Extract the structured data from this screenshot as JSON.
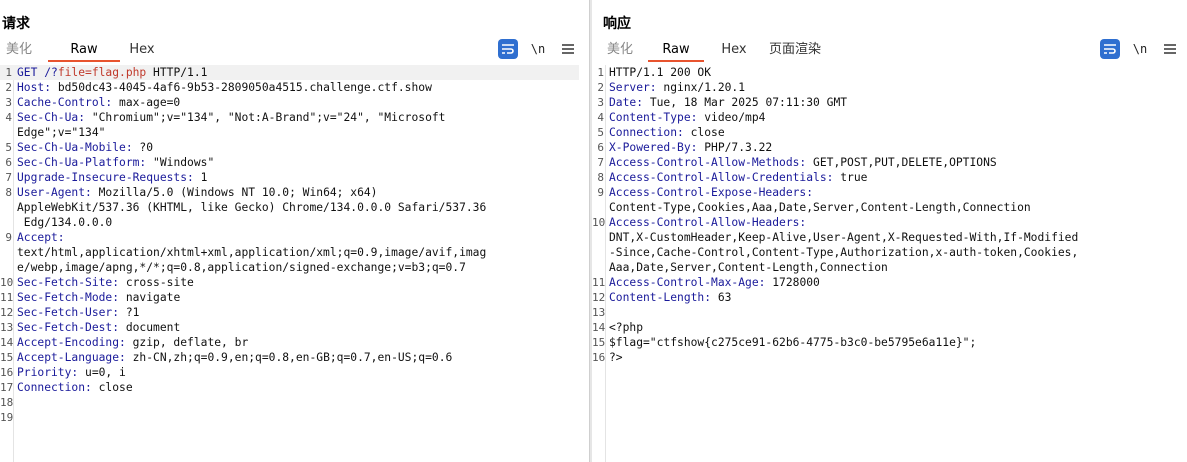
{
  "request": {
    "title": "请求",
    "tabs": [
      "美化",
      "Raw",
      "Hex"
    ],
    "active_tab": "Raw",
    "tool_newline": "\\n",
    "lines": [
      {
        "n": "1",
        "h": "GET /?",
        "p": "file=flag.php",
        "v": " HTTP/1.1"
      },
      {
        "n": "2",
        "h": "Host:",
        "v": " bd50dc43-4045-4af6-9b53-2809050a4515.challenge.ctf.show"
      },
      {
        "n": "3",
        "h": "Cache-Control:",
        "v": " max-age=0"
      },
      {
        "n": "4",
        "h": "Sec-Ch-Ua:",
        "v": " \"Chromium\";v=\"134\", \"Not:A-Brand\";v=\"24\", \"Microsoft"
      },
      {
        "n": "",
        "h": "",
        "v": "Edge\";v=\"134\""
      },
      {
        "n": "5",
        "h": "Sec-Ch-Ua-Mobile:",
        "v": " ?0"
      },
      {
        "n": "6",
        "h": "Sec-Ch-Ua-Platform:",
        "v": " \"Windows\""
      },
      {
        "n": "7",
        "h": "Upgrade-Insecure-Requests:",
        "v": " 1"
      },
      {
        "n": "8",
        "h": "User-Agent:",
        "v": " Mozilla/5.0 (Windows NT 10.0; Win64; x64)"
      },
      {
        "n": "",
        "h": "",
        "v": "AppleWebKit/537.36 (KHTML, like Gecko) Chrome/134.0.0.0 Safari/537.36"
      },
      {
        "n": "",
        "h": "",
        "v": " Edg/134.0.0.0"
      },
      {
        "n": "9",
        "h": "Accept:",
        "v": ""
      },
      {
        "n": "",
        "h": "",
        "v": "text/html,application/xhtml+xml,application/xml;q=0.9,image/avif,imag"
      },
      {
        "n": "",
        "h": "",
        "v": "e/webp,image/apng,*/*;q=0.8,application/signed-exchange;v=b3;q=0.7"
      },
      {
        "n": "10",
        "h": "Sec-Fetch-Site:",
        "v": " cross-site"
      },
      {
        "n": "11",
        "h": "Sec-Fetch-Mode:",
        "v": " navigate"
      },
      {
        "n": "12",
        "h": "Sec-Fetch-User:",
        "v": " ?1"
      },
      {
        "n": "13",
        "h": "Sec-Fetch-Dest:",
        "v": " document"
      },
      {
        "n": "14",
        "h": "Accept-Encoding:",
        "v": " gzip, deflate, br"
      },
      {
        "n": "15",
        "h": "Accept-Language:",
        "v": " zh-CN,zh;q=0.9,en;q=0.8,en-GB;q=0.7,en-US;q=0.6"
      },
      {
        "n": "16",
        "h": "Priority:",
        "v": " u=0, i"
      },
      {
        "n": "17",
        "h": "Connection:",
        "v": " close"
      },
      {
        "n": "18",
        "h": "",
        "v": ""
      },
      {
        "n": "19",
        "h": "",
        "v": ""
      }
    ]
  },
  "response": {
    "title": "响应",
    "tabs": [
      "美化",
      "Raw",
      "Hex",
      "页面渲染"
    ],
    "active_tab": "Raw",
    "tool_newline": "\\n",
    "lines": [
      {
        "n": "1",
        "h": "",
        "v": "HTTP/1.1 200 OK"
      },
      {
        "n": "2",
        "h": "Server:",
        "v": " nginx/1.20.1"
      },
      {
        "n": "3",
        "h": "Date:",
        "v": " Tue, 18 Mar 2025 07:11:30 GMT"
      },
      {
        "n": "4",
        "h": "Content-Type:",
        "v": " video/mp4"
      },
      {
        "n": "5",
        "h": "Connection:",
        "v": " close"
      },
      {
        "n": "6",
        "h": "X-Powered-By:",
        "v": " PHP/7.3.22"
      },
      {
        "n": "7",
        "h": "Access-Control-Allow-Methods:",
        "v": " GET,POST,PUT,DELETE,OPTIONS"
      },
      {
        "n": "8",
        "h": "Access-Control-Allow-Credentials:",
        "v": " true"
      },
      {
        "n": "9",
        "h": "Access-Control-Expose-Headers:",
        "v": ""
      },
      {
        "n": "",
        "h": "",
        "v": "Content-Type,Cookies,Aaa,Date,Server,Content-Length,Connection"
      },
      {
        "n": "10",
        "h": "Access-Control-Allow-Headers:",
        "v": ""
      },
      {
        "n": "",
        "h": "",
        "v": "DNT,X-CustomHeader,Keep-Alive,User-Agent,X-Requested-With,If-Modified"
      },
      {
        "n": "",
        "h": "",
        "v": "-Since,Cache-Control,Content-Type,Authorization,x-auth-token,Cookies,"
      },
      {
        "n": "",
        "h": "",
        "v": "Aaa,Date,Server,Content-Length,Connection"
      },
      {
        "n": "11",
        "h": "Access-Control-Max-Age:",
        "v": " 1728000"
      },
      {
        "n": "12",
        "h": "Content-Length:",
        "v": " 63"
      },
      {
        "n": "13",
        "h": "",
        "v": ""
      },
      {
        "n": "14",
        "h": "",
        "v": "<?php"
      },
      {
        "n": "15",
        "h": "",
        "v": "$flag=\"ctfshow{c275ce91-62b6-4775-b3c0-be5795e6a11e}\";"
      },
      {
        "n": "16",
        "h": "",
        "v": "?>"
      }
    ]
  },
  "colors": {
    "accent": "#e8542f",
    "primary": "#2f6fd0",
    "header": "#1a1a9a",
    "param": "#c0392b"
  },
  "icons": {
    "pretty": "wrap-lines-icon",
    "menu": "hamburger-menu-icon",
    "layout_split": "split-view-icon",
    "layout_horizontal": "horizontal-view-icon",
    "layout_single": "single-view-icon"
  }
}
